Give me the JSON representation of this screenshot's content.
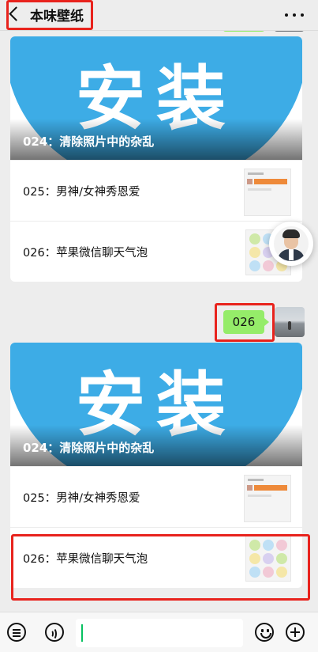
{
  "header": {
    "title": "本味壁纸",
    "back_icon": "chevron-left-icon",
    "more_icon": "more-dots-icon"
  },
  "cards": [
    {
      "banner_text": "安装",
      "banner_caption": "024：清除照片中的杂乱",
      "items": [
        {
          "label": "025：男神/女神秀恩爱"
        },
        {
          "label": "026：苹果微信聊天气泡"
        }
      ]
    },
    {
      "banner_text": "安装",
      "banner_caption": "024：清除照片中的杂乱",
      "items": [
        {
          "label": "025：男神/女神秀恩爱"
        },
        {
          "label": "026：苹果微信聊天气泡"
        }
      ]
    }
  ],
  "message": {
    "text": "026"
  },
  "input_bar": {
    "menu_icon": "menu-list-icon",
    "voice_icon": "voice-icon",
    "emoji_icon": "emoji-icon",
    "plus_icon": "plus-icon"
  },
  "colors": {
    "sent_bubble": "#95ec69",
    "banner_blue": "#3dace6",
    "highlight_red": "#e8231d",
    "background": "#ededed"
  }
}
